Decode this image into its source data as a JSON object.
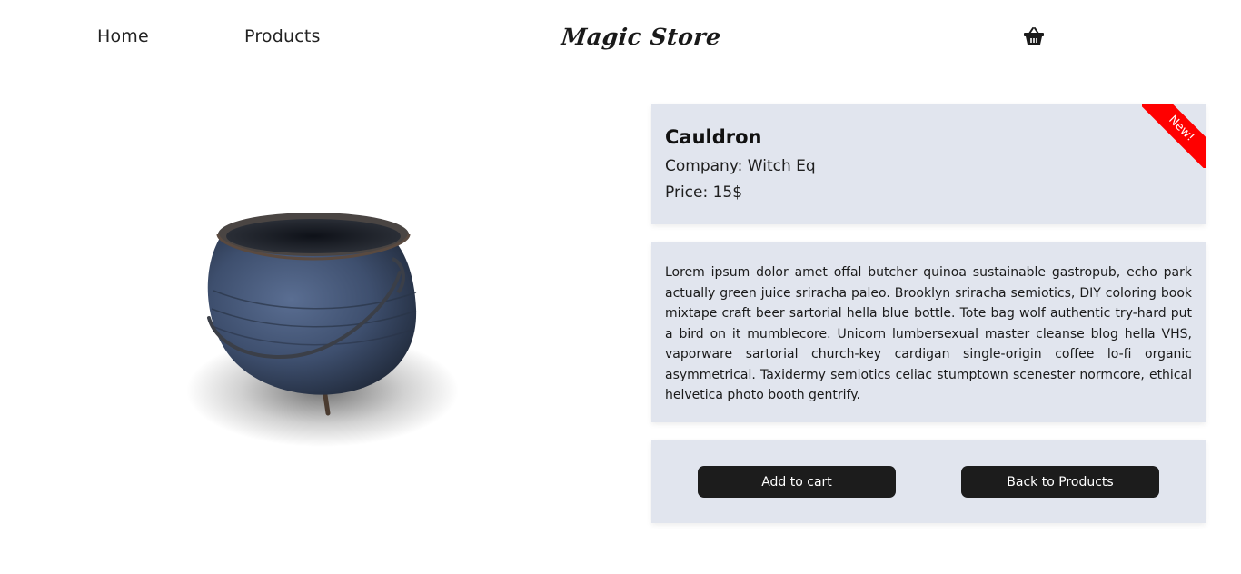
{
  "nav": {
    "home_label": "Home",
    "products_label": "Products",
    "logo_text": "Magic Store",
    "cart_icon": "shopping-basket-icon"
  },
  "product": {
    "name": "Cauldron",
    "company_label": "Company:",
    "company": "Witch Eq",
    "price_label": "Price:",
    "price": "15$",
    "badge": "New!",
    "description": "Lorem ipsum dolor amet offal butcher quinoa sustainable gastropub, echo park actually green juice sriracha paleo. Brooklyn sriracha semiotics, DIY coloring book mixtape craft beer sartorial hella blue bottle. Tote bag wolf authentic try-hard put a bird on it mumblecore. Unicorn lumbersexual master cleanse blog hella VHS, vaporware sartorial church-key cardigan single-origin coffee lo-fi organic asymmetrical. Taxidermy semiotics celiac stumptown scenester normcore, ethical helvetica photo booth gentrify.",
    "image_icon": "cauldron-image"
  },
  "actions": {
    "add_to_cart": "Add to cart",
    "back_to_products": "Back to Products"
  },
  "colors": {
    "card_bg": "#e1e5ee",
    "button_bg": "#1c1c1c",
    "badge_bg": "#ff0000",
    "cauldron_blue": "#3e4f6e"
  }
}
